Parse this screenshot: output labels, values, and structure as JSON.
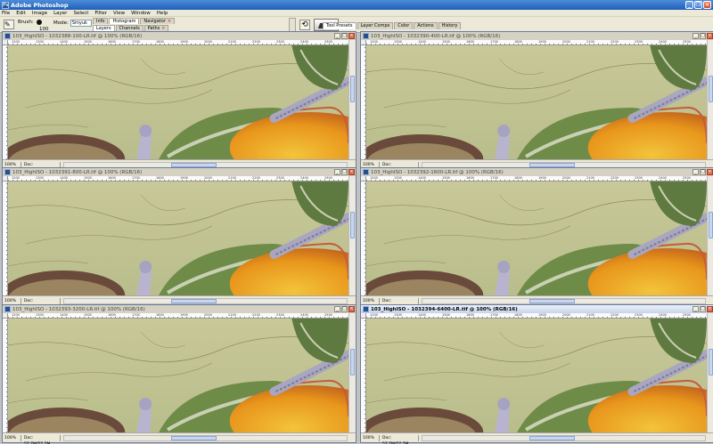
{
  "app": {
    "title": "Adobe Photoshop"
  },
  "menu": [
    "File",
    "Edit",
    "Image",
    "Layer",
    "Select",
    "Filter",
    "View",
    "Window",
    "Help"
  ],
  "options": {
    "brush_label": "Brush:",
    "brush_size": "100",
    "mode_label": "Mode:",
    "mode_value": "Smyuk"
  },
  "palettes": {
    "top_tabs": [
      "Info",
      "Histogram",
      "Navigator"
    ],
    "bottom_tabs": [
      "Layers",
      "Channels",
      "Paths"
    ],
    "dock_tabs": [
      "Tool Presets",
      "Layer Comps",
      "Color",
      "Actions",
      "History"
    ]
  },
  "ruler_labels": [
    "1200",
    "1300",
    "1400",
    "1500",
    "1600",
    "1700",
    "1800",
    "1900",
    "2000",
    "2100",
    "2200",
    "2300",
    "2400",
    "2500"
  ],
  "documents": [
    {
      "title": "103_HighISO - 1032388-100-LR.tif @ 100% (RGB/16)",
      "zoom": "100%",
      "doc_info": "Doc: 57.7M/57.7M",
      "active": false
    },
    {
      "title": "103_HighISO - 1032390-400-LR.tif @ 100% (RGB/16)",
      "zoom": "100%",
      "doc_info": "Doc: 57.7M/57.7M",
      "active": false
    },
    {
      "title": "103_HighISO - 1032391-800-LR.tif @ 100% (RGB/16)",
      "zoom": "100%",
      "doc_info": "Doc: 57.7M/57.7M",
      "active": false
    },
    {
      "title": "103_HighISO - 1032392-1600-LR.tif @ 100% (RGB/16)",
      "zoom": "100%",
      "doc_info": "Doc: 57.7M/57.7M",
      "active": false
    },
    {
      "title": "103_HighISO - 1032393-3200-LR.tif @ 100% (RGB/16)",
      "zoom": "100%",
      "doc_info": "Doc: 57.7M/57.7M",
      "active": false
    },
    {
      "title": "103_HighISO - 1032394-6400-LR.tif @ 100% (RGB/16)",
      "zoom": "100%",
      "doc_info": "Doc: 57.7M/57.7M",
      "active": true
    }
  ],
  "colors": {
    "title_bar": "#2a6bc8",
    "panel": "#ece9d8",
    "workspace": "#c2c2c2",
    "canvas_base": "#bfc38f",
    "orange_fruit": "#e8961c",
    "leaf": "#6f8b48"
  }
}
